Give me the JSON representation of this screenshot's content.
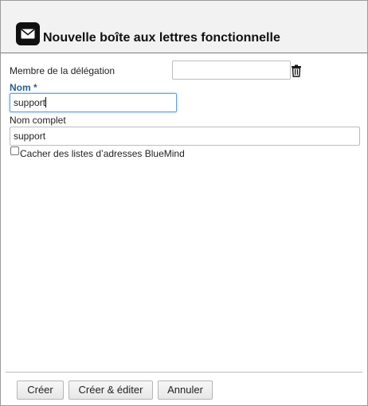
{
  "dialog": {
    "icon": "mailbox-icon",
    "title": "Nouvelle boîte aux lettres fonctionnelle"
  },
  "form": {
    "delegation_label": "Membre de la délégation",
    "delegation_value": "",
    "delete_icon": "trash-icon",
    "name_label": "Nom *",
    "name_value": "support",
    "fullname_label": "Nom complet",
    "fullname_value": "support",
    "hide_label": "Cacher des listes d’adresses BlueMind",
    "hide_checked": false
  },
  "footer": {
    "create_label": "Créer",
    "create_edit_label": "Créer & éditer",
    "cancel_label": "Annuler"
  }
}
